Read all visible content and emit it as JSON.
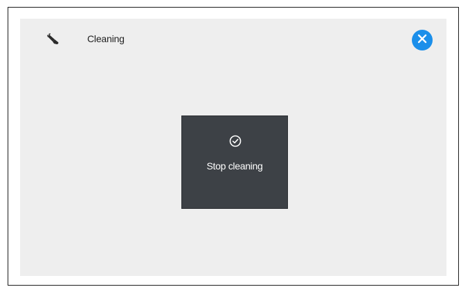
{
  "header": {
    "title": "Cleaning",
    "icon": "cleaning-brush-icon",
    "close_icon": "close-icon",
    "accent_color": "#1b8fea"
  },
  "action_tile": {
    "label": "Stop cleaning",
    "icon": "check-circle-icon",
    "background_color": "#3d4146"
  }
}
